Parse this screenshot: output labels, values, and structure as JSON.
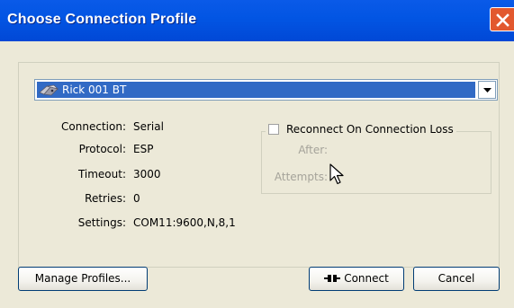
{
  "window": {
    "title": "Choose Connection Profile"
  },
  "profile_select": {
    "selected": "Rick 001 BT",
    "icon": "bluetooth-device-icon"
  },
  "details": {
    "connection": {
      "label": "Connection:",
      "value": "Serial"
    },
    "protocol": {
      "label": "Protocol:",
      "value": "ESP"
    },
    "timeout": {
      "label": "Timeout:",
      "value": "3000"
    },
    "retries": {
      "label": "Retries:",
      "value": "0"
    },
    "settings": {
      "label": "Settings:",
      "value": "COM11:9600,N,8,1"
    }
  },
  "reconnect": {
    "label": "Reconnect On Connection Loss",
    "checked": false,
    "after_label": "After:",
    "attempts_label": "Attempts:"
  },
  "buttons": {
    "manage": "Manage Profiles...",
    "connect": "Connect",
    "cancel": "Cancel"
  },
  "colors": {
    "titlebar": "#0255E3",
    "selection": "#316AC5",
    "close": "#E2582E",
    "window_bg": "#ECE9D8"
  }
}
